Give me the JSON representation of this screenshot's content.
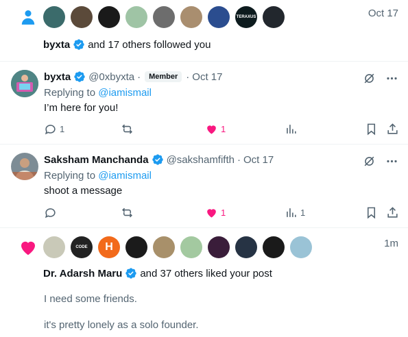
{
  "follow_notification": {
    "time": "Oct 17",
    "actor": "byxta",
    "text": "and 17 others followed you",
    "avatars": [
      {
        "bg": "#3b6b6b",
        "label": ""
      },
      {
        "bg": "#5b4a3a",
        "label": ""
      },
      {
        "bg": "#1a1a1a",
        "label": ""
      },
      {
        "bg": "#9fc4a5",
        "label": ""
      },
      {
        "bg": "#6d6d6d",
        "label": ""
      },
      {
        "bg": "#a98e6f",
        "label": ""
      },
      {
        "bg": "#2b4d8f",
        "label": ""
      },
      {
        "bg": "#0d1b1e",
        "label": "TERAXUS"
      },
      {
        "bg": "#22272d",
        "label": ""
      }
    ]
  },
  "tweet1": {
    "name": "byxta",
    "handle": "@0xbyxta",
    "sep": "·",
    "badge": "Member",
    "time": "Oct 17",
    "replying_prefix": "Replying to",
    "replying_to": "@iamismail",
    "text": "I’m here for you!",
    "replies": "1",
    "likes": "1",
    "views": ""
  },
  "tweet2": {
    "name": "Saksham Manchanda",
    "handle": "@sakshamfifth",
    "sep": "·",
    "time": "Oct 17",
    "replying_prefix": "Replying to",
    "replying_to": "@iamismail",
    "text": "shoot a message",
    "replies": "",
    "likes": "1",
    "views": "1"
  },
  "like_notification": {
    "time": "1m",
    "actor": "Dr. Adarsh Maru",
    "text": "and 37 others liked your post",
    "post_line1": "I need some friends.",
    "post_line2": "it's pretty lonely as a solo founder.",
    "avatars": [
      {
        "bg": "#c9c9b8",
        "label": ""
      },
      {
        "bg": "#222222",
        "label": "CODE"
      },
      {
        "bg": "#f26a1b",
        "label": "H"
      },
      {
        "bg": "#1b1b1b",
        "label": ""
      },
      {
        "bg": "#a8906a",
        "label": ""
      },
      {
        "bg": "#a3c9a0",
        "label": ""
      },
      {
        "bg": "#3a1d3a",
        "label": ""
      },
      {
        "bg": "#263344",
        "label": ""
      },
      {
        "bg": "#1a1a1a",
        "label": ""
      },
      {
        "bg": "#9ac3d6",
        "label": ""
      }
    ]
  },
  "colors": {
    "accent": "#1d9bf0",
    "like": "#f91880",
    "muted": "#536471"
  }
}
